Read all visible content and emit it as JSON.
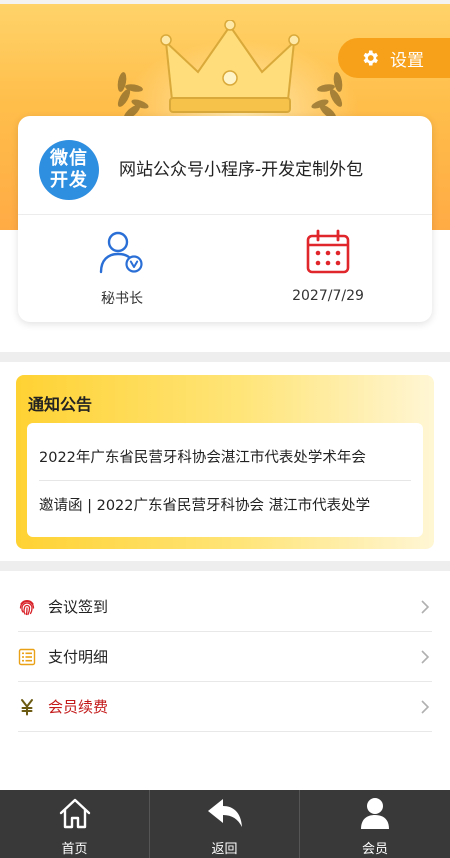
{
  "header": {
    "settings_label": "设置"
  },
  "profile": {
    "logo_line1": "微信",
    "logo_line2": "开发",
    "org_name": "网站公众号小程序-开发定制外包",
    "role_label": "秘书长",
    "date_label": "2027/7/29"
  },
  "notice": {
    "title": "通知公告",
    "items": [
      "2022年广东省民营牙科协会湛江市代表处学术年会",
      "邀请函 | 2022广东省民营牙科协会 湛江市代表处学"
    ]
  },
  "menu": {
    "items": [
      {
        "label": "会议签到",
        "icon": "fingerprint-icon"
      },
      {
        "label": "支付明细",
        "icon": "list-icon"
      },
      {
        "label": "会员续费",
        "icon": "yuan-icon"
      }
    ]
  },
  "bottom_nav": {
    "items": [
      {
        "label": "首页",
        "icon": "home-icon"
      },
      {
        "label": "返回",
        "icon": "back-arrow-icon"
      },
      {
        "label": "会员",
        "icon": "user-icon"
      }
    ]
  },
  "colors": {
    "accent_orange": "#f7a11a",
    "brand_blue": "#2e8ee0",
    "calendar_red": "#e0252b",
    "renew_red": "#c41a1a",
    "nav_bg": "#393939"
  }
}
